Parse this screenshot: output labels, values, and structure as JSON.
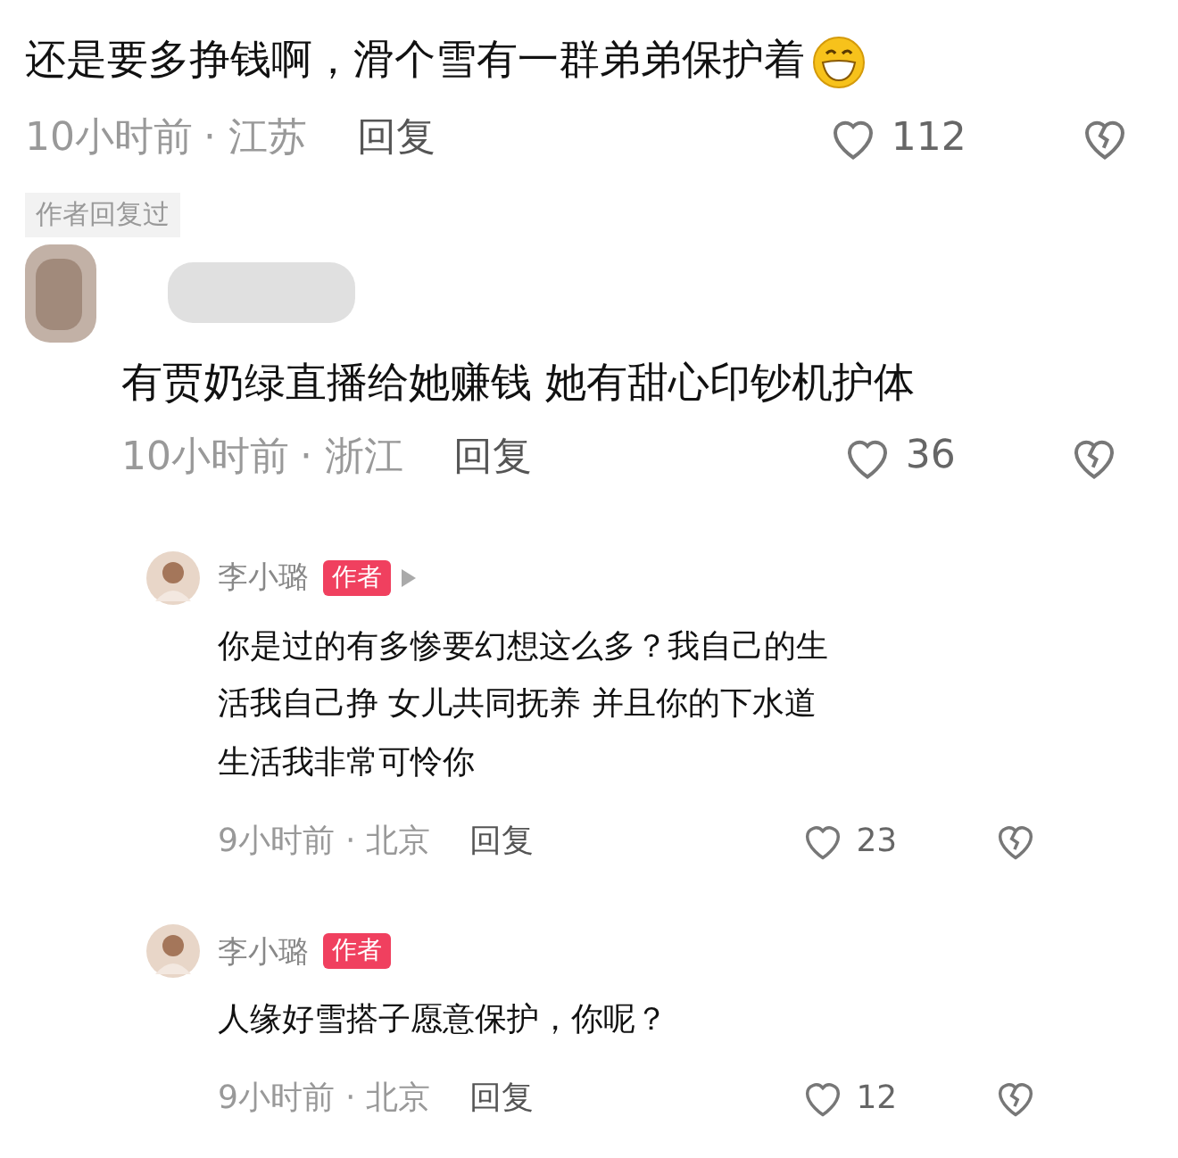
{
  "comment": {
    "text": "还是要多挣钱啊，滑个雪有一群弟弟保护着",
    "time": "10小时前",
    "location": "· 江苏",
    "reply_label": "回复",
    "likes": "112",
    "author_replied": "作者回复过"
  },
  "reply": {
    "text": "有贾奶绿直播给她赚钱 她有甜心印钞机护体",
    "time": "10小时前",
    "location": "· 浙江",
    "reply_label": "回复",
    "likes": "36"
  },
  "sub_replies": [
    {
      "name": "李小璐",
      "badge": "作者",
      "has_arrow": true,
      "text": "你是过的有多惨要幻想这么多？我自己的生活我自己挣 女儿共同抚养 并且你的下水道生活我非常可怜你",
      "time": "9小时前",
      "location": "· 北京",
      "reply_label": "回复",
      "likes": "23"
    },
    {
      "name": "李小璐",
      "badge": "作者",
      "has_arrow": false,
      "text": "人缘好雪搭子愿意保护，你呢？",
      "time": "9小时前",
      "location": "· 北京",
      "reply_label": "回复",
      "likes": "12"
    }
  ]
}
